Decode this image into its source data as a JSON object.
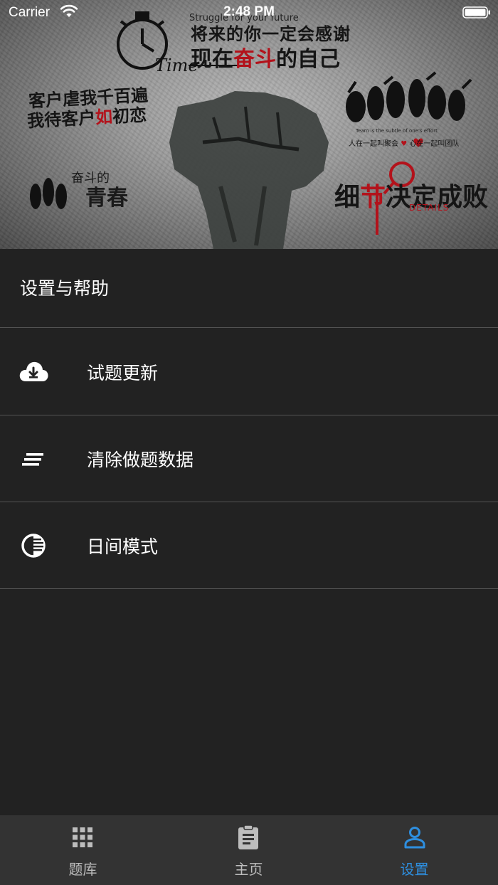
{
  "status_bar": {
    "carrier": "Carrier",
    "time": "2:48 PM"
  },
  "banner": {
    "struggle_en": "Struggle for your future",
    "line_future": "将来的你一定会感谢",
    "line_now_a": "现在",
    "line_now_b": "奋斗",
    "line_now_c": "的自己",
    "time_word": "Time",
    "abuse_line1": "客户虐我千百遍",
    "abuse_line2_a": "我待客户",
    "abuse_line2_b": "如",
    "abuse_line2_c": "初恋",
    "fendou_de": "奋斗的",
    "youth": "青春",
    "team_en": "Team is the subtle of one's effort",
    "team_a": "人在一起叫聚会",
    "team_b": "心在一起叫团队",
    "detail_a": "细",
    "detail_b": "节",
    "detail_c": "决定成败",
    "details_en": "DETAILS"
  },
  "settings": {
    "section_title": "设置与帮助",
    "items": [
      {
        "label": "试题更新",
        "icon": "cloud-download-icon"
      },
      {
        "label": "清除做题数据",
        "icon": "clear-all-icon"
      },
      {
        "label": "日间模式",
        "icon": "contrast-icon"
      }
    ]
  },
  "tabbar": {
    "tabs": [
      {
        "label": "题库",
        "icon": "grid-icon",
        "active": false
      },
      {
        "label": "主页",
        "icon": "clipboard-icon",
        "active": false
      },
      {
        "label": "设置",
        "icon": "person-icon",
        "active": true
      }
    ]
  },
  "colors": {
    "background": "#222222",
    "divider": "#555555",
    "tabbar_bg": "#333333",
    "tab_inactive": "#bdbdbd",
    "tab_active": "#2e8fe0",
    "accent_red": "#b3121b"
  }
}
